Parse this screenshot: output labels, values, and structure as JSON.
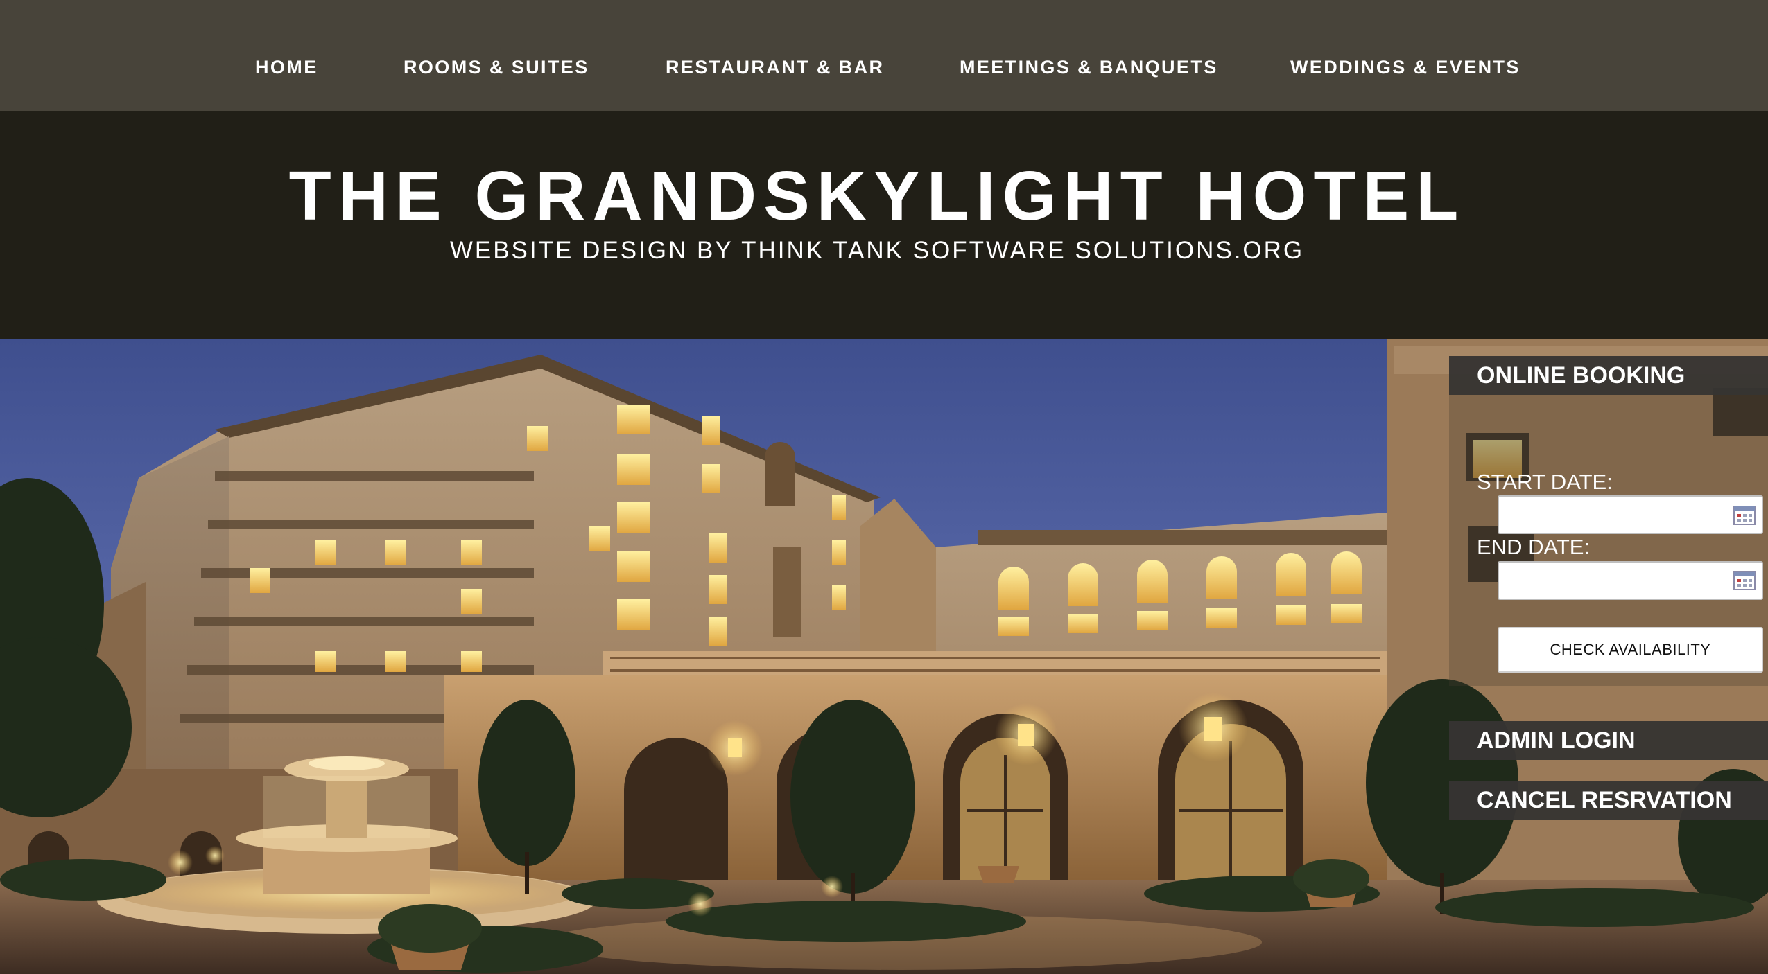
{
  "nav": {
    "items": [
      {
        "label": "HOME"
      },
      {
        "label": "ROOMS & SUITES"
      },
      {
        "label": "RESTAURANT & BAR"
      },
      {
        "label": "MEETINGS & BANQUETS"
      },
      {
        "label": "WEDDINGS & EVENTS"
      }
    ]
  },
  "header": {
    "title": "THE GRANDSKYLIGHT HOTEL",
    "subtitle": "WEBSITE DESIGN BY THINK TANK SOFTWARE SOLUTIONS.ORG"
  },
  "booking": {
    "heading": "ONLINE BOOKING",
    "start_label": "START DATE:",
    "start_value": "",
    "end_label": "END DATE:",
    "end_value": "",
    "calendar_icon": "calendar-icon",
    "check_label": "CHECK AVAILABILITY"
  },
  "admin": {
    "login_label": "ADMIN LOGIN",
    "cancel_label": "CANCEL RESRVATION"
  },
  "colors": {
    "nav_bg": "#48443a",
    "header_bg": "#211f17",
    "panel_heading_bg": "#363432",
    "text": "#ffffff"
  }
}
